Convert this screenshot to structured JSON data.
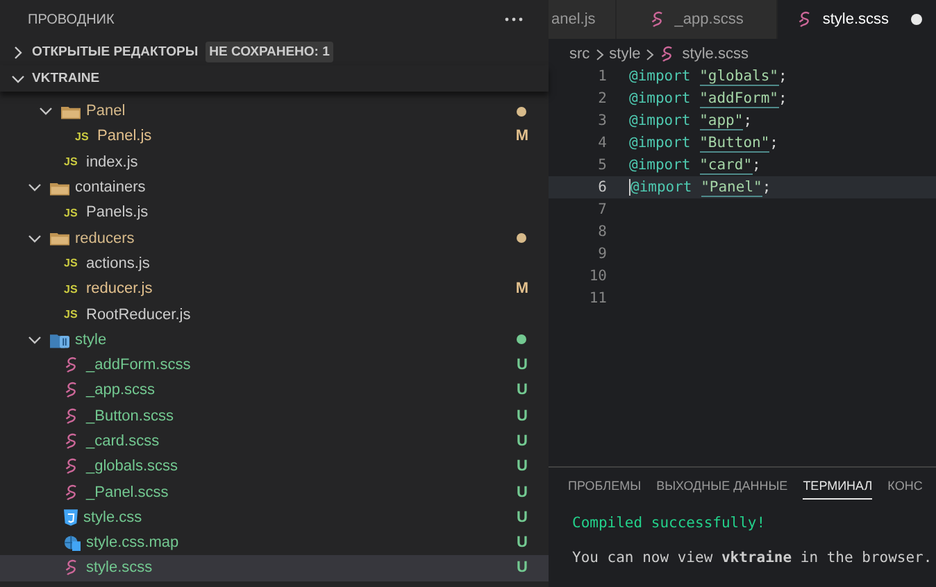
{
  "explorer": {
    "title": "ПРОВОДНИК",
    "open_editors": {
      "label": "ОТКРЫТЫЕ РЕДАКТОРЫ",
      "expanded": false,
      "badge": "НЕ СОХРАНЕНО: 1"
    },
    "project": {
      "label": "VKTRAINE",
      "expanded": true
    },
    "tree": [
      {
        "children": [
          {
            "label": "Panel",
            "kind": "folder",
            "color": "#d7ba8a",
            "expanded": true,
            "selected": false,
            "children": [
              {
                "label": "Panel.js",
                "kind": "js-file",
                "icon_label": "JS",
                "color": "#e2c08d",
                "badge": "M",
                "selected": false
              }
            ]
          },
          {
            "label": "index.js",
            "kind": "js-file",
            "icon_label": "JS",
            "selected": false
          }
        ]
      },
      {
        "label": "containers",
        "kind": "folder",
        "expanded": true,
        "selected": false,
        "children": [
          {
            "label": "Panels.js",
            "kind": "js-file",
            "icon_label": "JS",
            "selected": false
          }
        ]
      },
      {
        "label": "reducers",
        "kind": "folder",
        "color": "#d7ba8a",
        "expanded": true,
        "selected": false,
        "children": [
          {
            "label": "actions.js",
            "kind": "js-file",
            "icon_label": "JS",
            "selected": false
          },
          {
            "label": "reducer.js",
            "kind": "js-file",
            "icon_label": "JS",
            "color": "#e2c08d",
            "badge": "M",
            "selected": false
          },
          {
            "label": "RootReducer.js",
            "kind": "js-file",
            "icon_label": "JS",
            "selected": false
          }
        ]
      },
      {
        "label": "style",
        "kind": "style-folder",
        "color": "#73c991",
        "expanded": true,
        "selected": false,
        "children": [
          {
            "label": "_addForm.scss",
            "kind": "scss-file",
            "color": "#73c991",
            "badge": "U",
            "selected": false
          },
          {
            "label": "_app.scss",
            "kind": "scss-file",
            "color": "#73c991",
            "badge": "U",
            "selected": false
          },
          {
            "label": "_Button.scss",
            "kind": "scss-file",
            "color": "#73c991",
            "badge": "U",
            "selected": false
          },
          {
            "label": "_card.scss",
            "kind": "scss-file",
            "color": "#73c991",
            "badge": "U",
            "selected": false
          },
          {
            "label": "_globals.scss",
            "kind": "scss-file",
            "color": "#73c991",
            "badge": "U",
            "selected": false
          },
          {
            "label": "_Panel.scss",
            "kind": "scss-file",
            "color": "#73c991",
            "badge": "U",
            "selected": false
          },
          {
            "label": "style.css",
            "kind": "css-file",
            "color": "#73c991",
            "badge": "U",
            "selected": false
          },
          {
            "label": "style.css.map",
            "kind": "map-file",
            "color": "#73c991",
            "badge": "U",
            "selected": false
          },
          {
            "label": "style.scss",
            "kind": "scss-file",
            "color": "#73c991",
            "badge": "U",
            "selected": true
          }
        ]
      }
    ]
  },
  "editor": {
    "tabs": [
      {
        "label": "anel.js",
        "selected": false,
        "dirty": false
      },
      {
        "label": "_app.scss",
        "kind": "scss-file",
        "selected": false,
        "dirty": false
      },
      {
        "label": "style.scss",
        "kind": "scss-file",
        "selected": true,
        "dirty": true
      }
    ],
    "breadcrumb": [
      "src",
      "style",
      "style.scss"
    ],
    "lines": [
      {
        "number": "1",
        "keyword": "@import",
        "string": "\"globals\"",
        "punct": ";",
        "current": false
      },
      {
        "number": "2",
        "keyword": "@import",
        "string": "\"addForm\"",
        "punct": ";",
        "current": false
      },
      {
        "number": "3",
        "keyword": "@import",
        "string": "\"app\"",
        "punct": ";",
        "current": false
      },
      {
        "number": "4",
        "keyword": "@import",
        "string": "\"Button\"",
        "punct": ";",
        "current": false
      },
      {
        "number": "5",
        "keyword": "@import",
        "string": "\"card\"",
        "punct": ";",
        "current": false
      },
      {
        "number": "6",
        "keyword": "@import",
        "string": "\"Panel\"",
        "punct": ";",
        "current": true
      },
      {
        "number": "7",
        "current": false
      },
      {
        "number": "8",
        "current": false
      },
      {
        "number": "9",
        "current": false
      },
      {
        "number": "10",
        "current": false
      },
      {
        "number": "11",
        "current": false
      }
    ]
  },
  "panel": {
    "tabs": [
      {
        "label": "ПРОБЛЕМЫ",
        "selected": false
      },
      {
        "label": "ВЫХОДНЫЕ ДАННЫЕ",
        "selected": false
      },
      {
        "label": "ТЕРМИНАЛ",
        "selected": true
      },
      {
        "label": "КОНС",
        "selected": false
      }
    ],
    "terminal": [
      {
        "text": "Compiled successfully!",
        "kind": "success"
      },
      {
        "text": "You can now view **vktraine** in the browser.",
        "kind": "plain"
      }
    ]
  }
}
